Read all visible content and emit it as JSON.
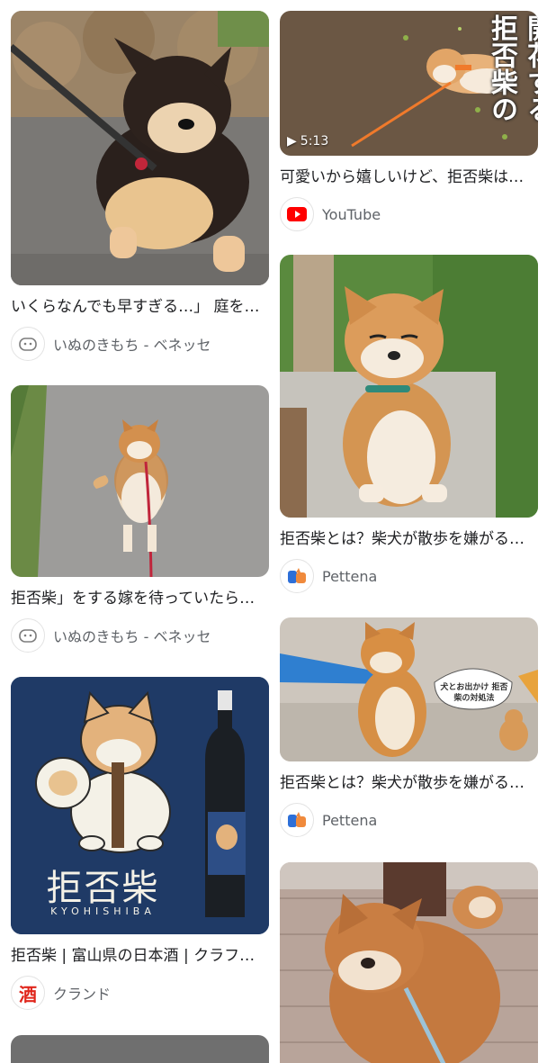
{
  "results": [
    {
      "caption": "いくらなんでも早すぎる…」 庭を…",
      "source": "いぬのきもち - ベネッセ",
      "favicon": "inunokimochi-icon"
    },
    {
      "caption": "拒否柴」をする嫁を待っていたら…",
      "source": "いぬのきもち - ベネッセ",
      "favicon": "inunokimochi-icon"
    },
    {
      "caption": "拒否柴 | 富山県の日本酒 | クラフト…",
      "source": "クランド",
      "favicon": "sake-kanji-icon",
      "favicon_text": "酒",
      "image_title": "拒否柴",
      "image_subtitle": "KYOHISHIBA"
    },
    {
      "caption": "可愛いから嬉しいけど、拒否柴は…",
      "source": "YouTube",
      "favicon": "youtube-icon",
      "duration": "5:13",
      "overlay_col1": "開花する",
      "overlay_col2": "拒否柴の"
    },
    {
      "caption": "拒否柴とは？柴犬が散歩を嫌がる…",
      "source": "Pettena",
      "favicon": "pettena-icon"
    },
    {
      "caption": "拒否柴とは？柴犬が散歩を嫌がる…",
      "source": "Pettena",
      "favicon": "pettena-icon",
      "bubble_text": "犬とお出かけ 拒否柴の対処法"
    }
  ],
  "colors": {
    "youtube_red": "#ff0000",
    "sake_navy": "#1f3a66",
    "pettena_blue": "#2d6fd8",
    "pettena_orange": "#f08a3c"
  }
}
